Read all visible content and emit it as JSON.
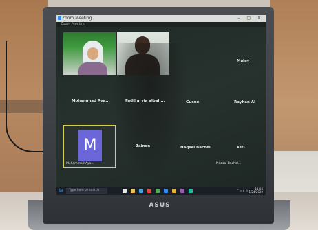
{
  "window": {
    "title": "Zoom Meeting",
    "subtitle": "Zoom Meeting"
  },
  "participants": [
    {
      "name": "Mohammad Aya..."
    },
    {
      "name": "Fadil arvia albah..."
    },
    {
      "name": "Gusno"
    },
    {
      "name": "Rayhan Al"
    },
    {
      "name": "Malay"
    },
    {
      "name": "Zainon"
    },
    {
      "name": "Naqsal Bachel"
    },
    {
      "name": "Kiki"
    },
    {
      "name": "Naqsal Bachel..."
    }
  ],
  "tile_m": {
    "initial": "M",
    "label": "Mohammad Aya..."
  },
  "taskbar": {
    "search_placeholder": "Type here to search",
    "time": "11:04",
    "date": "1/24/2022"
  },
  "laptop": {
    "brand": "ASUS"
  },
  "colors": {
    "avatar": "#6c67d8",
    "active_speaker_border": "#d8d24a",
    "taskbar": "#1a1f26"
  }
}
